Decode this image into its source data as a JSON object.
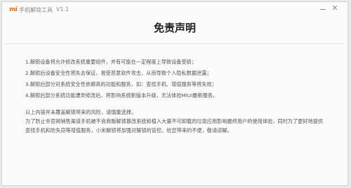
{
  "app": {
    "logo": "mi",
    "title": "手机解锁工具",
    "version": "V1.1"
  },
  "dialog": {
    "title": "免责声明",
    "items": [
      "1.解锁设备将允许修改系统重要组件，并有可能在一定程度上导致设备受损；",
      "2.解锁后设备安全性将失去保证，易受恶意软件攻击，从而导致个人隐私数据泄露；",
      "3.解锁后部分对系统安全性依赖高的功能和服务，如：查找手机、增值服务等将失效；",
      "4.解锁后部分系统功能遭到修改后，将影响系统新版本升级，无法体验MIUI最新服务。"
    ],
    "notice_line1": "以上内容并未覆盖解锁带来的风险，请慎重选择。",
    "notice_line2": "为了防止非官网销售渠道手机被不良商贩解锁篡改系统和植入大量不可卸载的垃圾应用影响最终用户的使用体验，同时为了更好地提供查找手机和防失窃等增值服务，小米解锁将加强对解锁的管控。给您带来的不便，敬请谅解。"
  },
  "icons": {
    "minimize": "minimize-icon",
    "close": "close-icon"
  },
  "colors": {
    "brand": "#ff6a00"
  }
}
